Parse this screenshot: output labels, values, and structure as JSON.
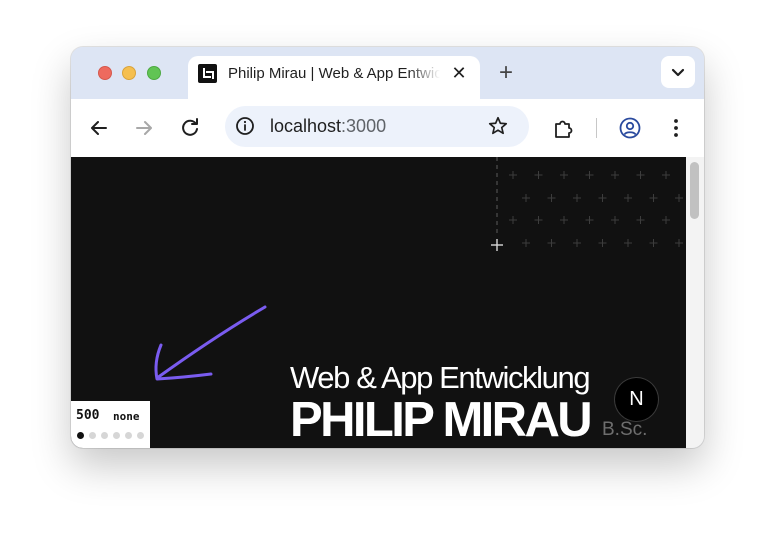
{
  "browser": {
    "tab": {
      "title": "Philip Mirau | Web & App Entwicklung",
      "close_glyph": "✕"
    },
    "new_tab_glyph": "+",
    "address_bar": {
      "host": "localhost",
      "port": ":3000"
    },
    "icons": {
      "back": "arrow-left-icon",
      "forward": "arrow-right-icon",
      "reload": "reload-icon",
      "site_info": "info-icon",
      "bookmark": "star-icon",
      "extensions": "puzzle-icon",
      "profile": "profile-icon",
      "menu": "kebab-menu-icon",
      "tab_search": "chevron-down-icon"
    }
  },
  "page": {
    "hero": {
      "subtitle": "Web & App Entwicklung",
      "name": "PHILIP MIRAU",
      "degree": "B.Sc."
    },
    "next_badge": "N",
    "dev_indicator": {
      "value": "500",
      "state": "none",
      "dots_total": 6,
      "active_dot": 1
    }
  },
  "colors": {
    "page_background": "#111111",
    "arrow_stroke": "#7a5cf0",
    "tabstrip": "#dde5f4",
    "omnibox": "#edf2fb"
  }
}
